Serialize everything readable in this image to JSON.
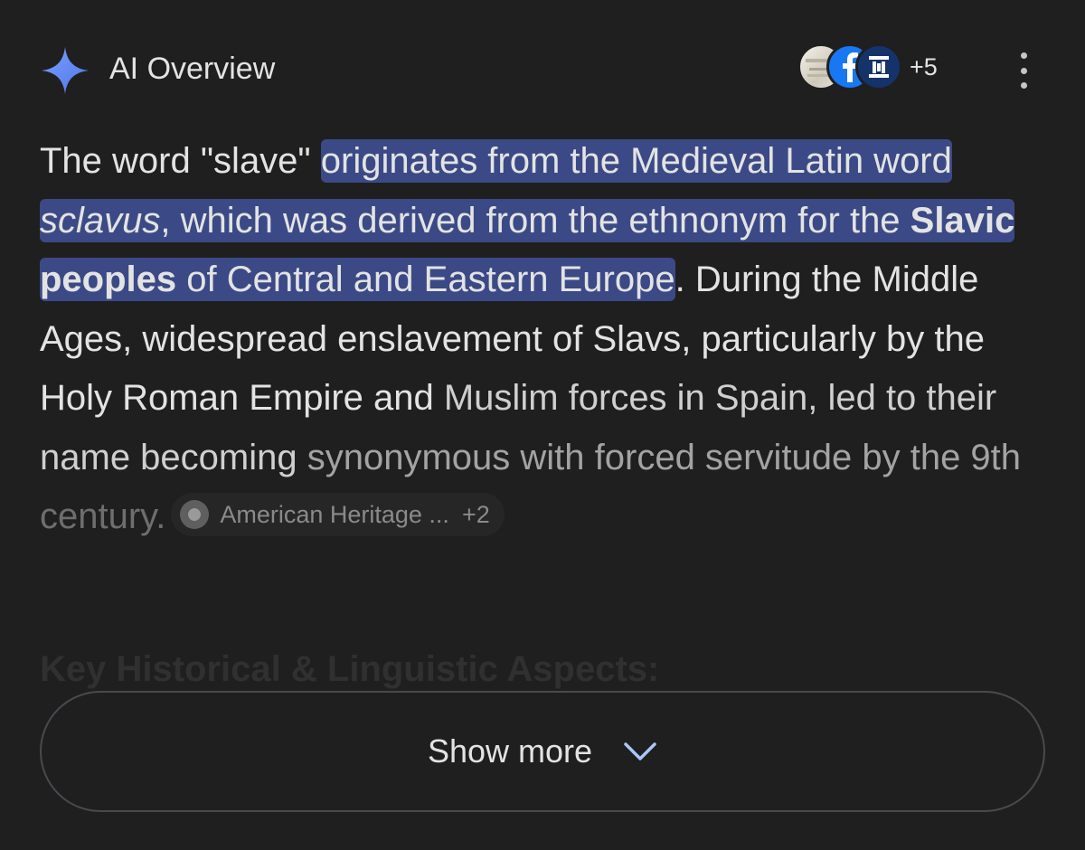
{
  "header": {
    "title": "AI Overview",
    "sources_more": "+5",
    "source_icons": [
      "source-thumbnail-icon",
      "facebook-icon",
      "institution-icon"
    ]
  },
  "body": {
    "intro": "The word \"slave\" ",
    "hl_part1": "originates from the Medieval Latin word ",
    "hl_italic": "sclavus",
    "hl_part2": ", which was derived from the ethnonym for the ",
    "hl_bold": "Slavic peoples",
    "hl_part3": " of Central and Eastern Europe",
    "after_hl": ".",
    "sentence2_a": " During the Middle Ages, widespread enslavement of Slavs, particularly by the Holy Roman Empire and ",
    "sentence2_b": "Muslim forces in Spain, led to their name becoming ",
    "sentence2_c": "synonymous with forced servitude by the 9th ",
    "sentence2_d": "century."
  },
  "citation": {
    "label": "American Heritage ...",
    "extra": "+2"
  },
  "faded_heading": "Key Historical & Linguistic Aspects:",
  "show_more": {
    "label": "Show more"
  },
  "colors": {
    "background": "#1f1f1f",
    "highlight": "#3b4a86",
    "sparkle": "#6b8cf5"
  }
}
